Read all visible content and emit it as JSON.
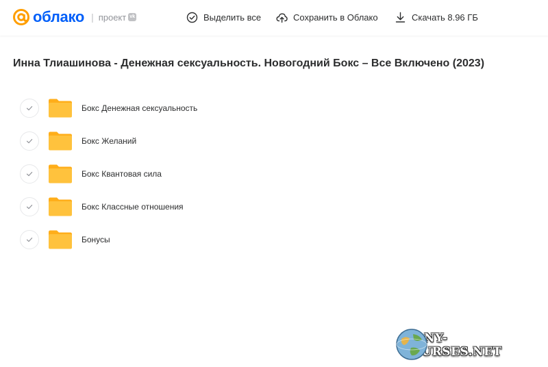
{
  "header": {
    "logo_text": "облако",
    "project_label": "проект",
    "vk_badge": "vk",
    "select_all": "Выделить все",
    "save_to_cloud": "Сохранить в Облако",
    "download": "Скачать 8.96 ГБ"
  },
  "page": {
    "title": "Инна Тлиашинова - Денежная сексуальность. Новогодний Бокс – Все Включено (2023)"
  },
  "folders": [
    {
      "name": "Бокс Денежная сексуальность"
    },
    {
      "name": "Бокс Желаний"
    },
    {
      "name": "Бокс Квантовая сила"
    },
    {
      "name": "Бокс Классные отношения"
    },
    {
      "name": "Бонусы"
    }
  ],
  "watermark": {
    "text": "MANY-COURSES.NET"
  },
  "colors": {
    "brand": "#005ff9",
    "logo_orange": "#ff9e00",
    "folder": "#ffc23d",
    "folder_back": "#ffae1a"
  }
}
